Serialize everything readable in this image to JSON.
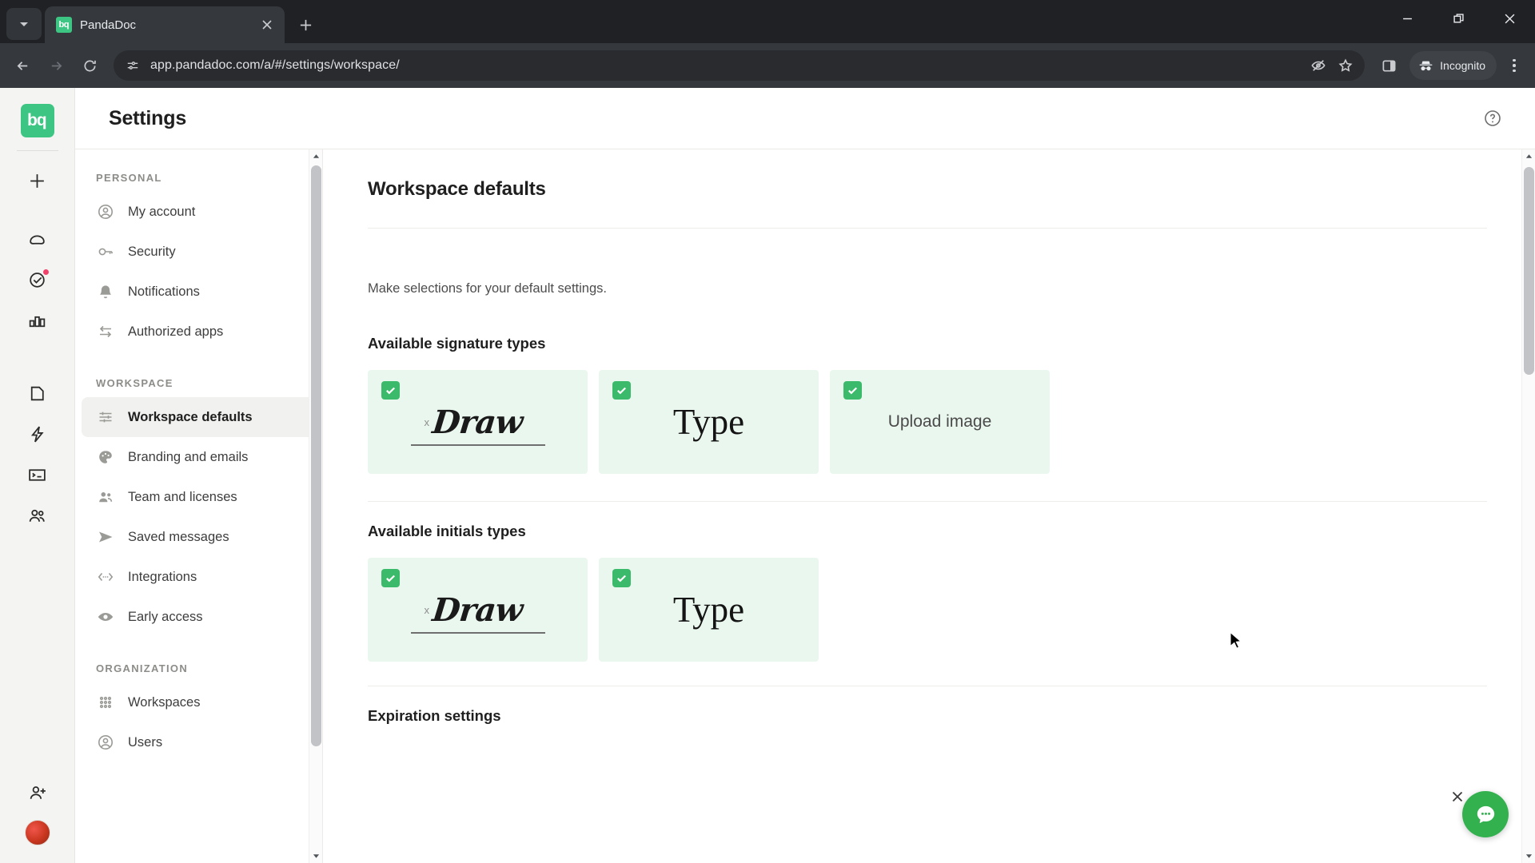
{
  "browser": {
    "tab": {
      "title": "PandaDoc",
      "favicon_label": "pd",
      "favicon_color": "#3cc583"
    },
    "tab_search_name": "tab-search",
    "new_tab_label": "+",
    "url": "app.pandadoc.com/a/#/settings/workspace/",
    "profile_label": "Incognito",
    "toolbar_icons": [
      "back-arrow",
      "forward-arrow",
      "reload",
      "site-settings",
      "tracking-protection",
      "bookmark-star",
      "side-panel",
      "incognito",
      "three-dot-menu"
    ],
    "window_controls": [
      "minimize",
      "restore",
      "close"
    ]
  },
  "rail": {
    "logo_label": "pd",
    "items": [
      {
        "name": "create-new",
        "icon": "plus-icon"
      },
      {
        "name": "home",
        "icon": "home-icon"
      },
      {
        "name": "tasks",
        "icon": "check-circle-icon",
        "badge": true
      },
      {
        "name": "reporting",
        "icon": "bar-chart-icon"
      },
      {
        "name": "documents",
        "icon": "document-icon"
      },
      {
        "name": "quick-actions",
        "icon": "lightning-icon"
      },
      {
        "name": "forms",
        "icon": "form-icon"
      },
      {
        "name": "contacts",
        "icon": "people-icon"
      },
      {
        "name": "invite-user",
        "icon": "person-add-icon"
      },
      {
        "name": "avatar",
        "icon": "avatar"
      }
    ]
  },
  "header": {
    "title": "Settings",
    "help_icon": "question-circle-icon"
  },
  "nav": {
    "groups": [
      {
        "label": "PERSONAL",
        "items": [
          {
            "label": "My account",
            "icon": "person-circle-icon",
            "active": false
          },
          {
            "label": "Security",
            "icon": "key-icon",
            "active": false
          },
          {
            "label": "Notifications",
            "icon": "bell-icon",
            "active": false
          },
          {
            "label": "Authorized apps",
            "icon": "exchange-arrows-icon",
            "active": false
          }
        ]
      },
      {
        "label": "WORKSPACE",
        "items": [
          {
            "label": "Workspace defaults",
            "icon": "sliders-icon",
            "active": true
          },
          {
            "label": "Branding and emails",
            "icon": "palette-icon",
            "active": false
          },
          {
            "label": "Team and licenses",
            "icon": "people-icon",
            "active": false
          },
          {
            "label": "Saved messages",
            "icon": "send-icon",
            "active": false
          },
          {
            "label": "Integrations",
            "icon": "code-brackets-icon",
            "active": false
          },
          {
            "label": "Early access",
            "icon": "eye-icon",
            "active": false
          }
        ]
      },
      {
        "label": "ORGANIZATION",
        "items": [
          {
            "label": "Workspaces",
            "icon": "grid-dots-icon",
            "active": false
          },
          {
            "label": "Users",
            "icon": "person-circle-icon",
            "active": false
          }
        ]
      }
    ]
  },
  "main": {
    "title": "Workspace defaults",
    "lead": "Make selections for your default settings.",
    "signature_section": {
      "heading": "Available signature types",
      "cards": [
        {
          "label": "Draw",
          "kind": "draw",
          "checked": true,
          "x_mark": "x"
        },
        {
          "label": "Type",
          "kind": "type",
          "checked": true
        },
        {
          "label": "Upload image",
          "kind": "upload",
          "checked": true
        }
      ]
    },
    "initials_section": {
      "heading": "Available initials types",
      "cards": [
        {
          "label": "Draw",
          "kind": "draw",
          "checked": true,
          "x_mark": "x"
        },
        {
          "label": "Type",
          "kind": "type",
          "checked": true
        }
      ]
    },
    "expiration_heading": "Expiration settings"
  },
  "chat": {
    "fab_icon": "chat-bubble-icon",
    "close_icon": "close-icon",
    "color": "#34b14f"
  },
  "colors": {
    "accent_green": "#3cc583",
    "card_green": "#eaf7ee",
    "checkbox_green": "#3cba6b",
    "chrome_dark": "#202124",
    "toolbar_dark": "#35383d"
  }
}
